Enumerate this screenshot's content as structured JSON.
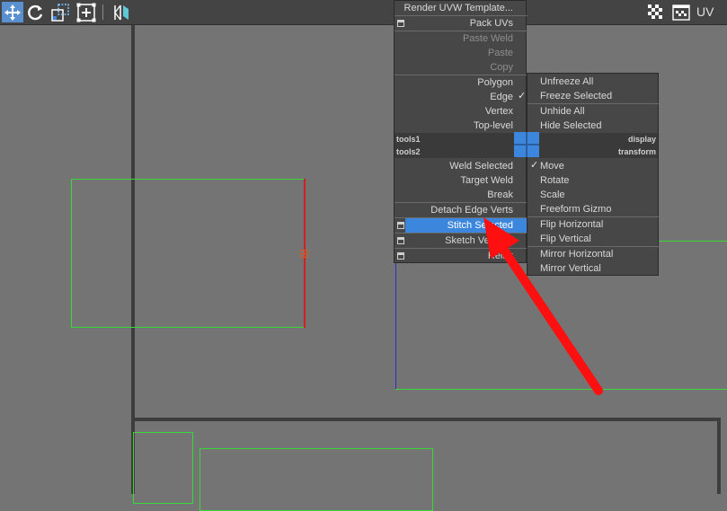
{
  "toolbar": {
    "buttons": [
      "move-icon",
      "rotate-icon",
      "scale-icon",
      "freeform-icon",
      "mirror-icon"
    ],
    "right_icons": [
      "checker-pattern-icon",
      "checker-map-icon"
    ],
    "uv_label": "UV"
  },
  "menu": {
    "left": {
      "render_uvw": "Render UVW Template...",
      "pack_uvs": "Pack UVs",
      "paste_weld": "Paste Weld",
      "paste": "Paste",
      "copy": "Copy",
      "polygon": "Polygon",
      "edge": "Edge",
      "vertex": "Vertex",
      "top_level": "Top-level",
      "tools1": "tools1",
      "tools2": "tools2",
      "weld_selected": "Weld Selected",
      "target_weld": "Target Weld",
      "break": "Break",
      "detach_edge_verts": "Detach Edge Verts",
      "stitch_selected": "Stitch Selected",
      "sketch_vertices": "Sketch Vertices",
      "relax": "Relax",
      "edge_check": "✓"
    },
    "right": {
      "unfreeze_all": "Unfreeze All",
      "freeze_selected": "Freeze Selected",
      "unhide_all": "Unhide All",
      "hide_selected": "Hide Selected",
      "display": "display",
      "transform": "transform",
      "move": "Move",
      "rotate": "Rotate",
      "scale": "Scale",
      "freeform_gizmo": "Freeform Gizmo",
      "flip_horizontal": "Flip Horizontal",
      "flip_vertical": "Flip Vertical",
      "mirror_horizontal": "Mirror Horizontal",
      "mirror_vertical": "Mirror Vertical",
      "move_check": "✓"
    }
  },
  "colors": {
    "accent": "#3c86de",
    "uv_edge": "#39d839",
    "selected_edge": "#d02020",
    "annotation_arrow": "#ff1010"
  }
}
